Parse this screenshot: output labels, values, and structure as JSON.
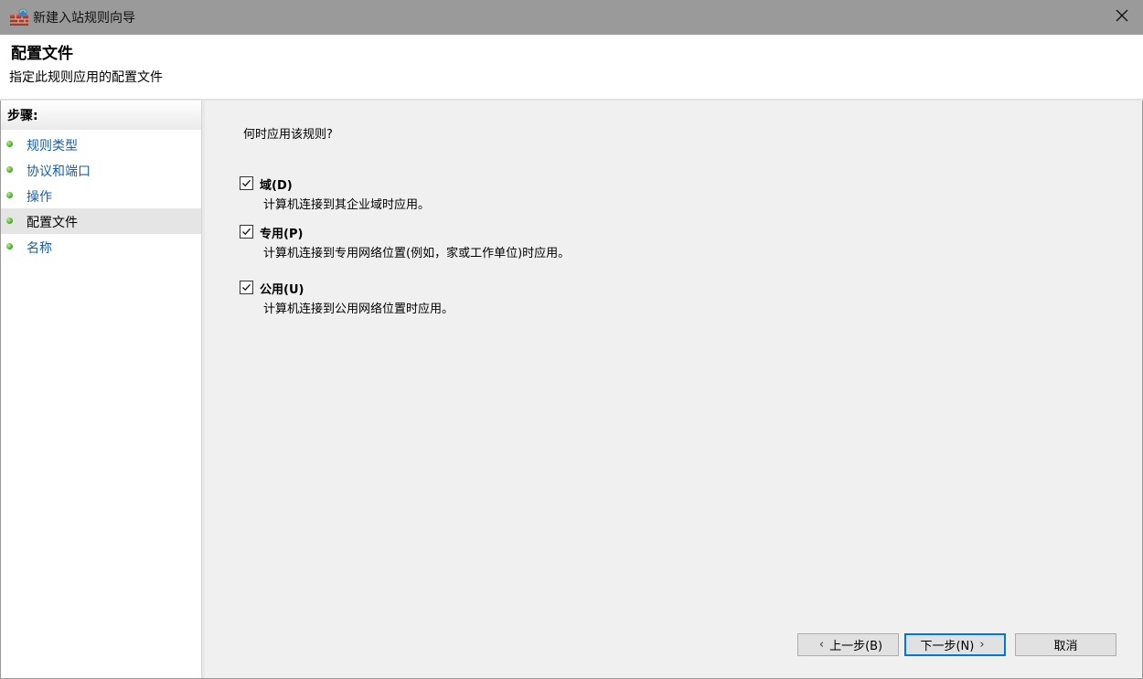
{
  "window": {
    "title": "新建入站规则向导",
    "icon": "firewall-wizard-icon",
    "close_icon": "close-icon"
  },
  "header": {
    "title": "配置文件",
    "subtitle": "指定此规则应用的配置文件"
  },
  "sidebar": {
    "title": "步骤:",
    "items": [
      {
        "label": "规则类型",
        "active": false
      },
      {
        "label": "协议和端口",
        "active": false
      },
      {
        "label": "操作",
        "active": false
      },
      {
        "label": "配置文件",
        "active": true
      },
      {
        "label": "名称",
        "active": false
      }
    ]
  },
  "main": {
    "question": "何时应用该规则?",
    "options": [
      {
        "label": "域(D)",
        "description": "计算机连接到其企业域时应用。",
        "checked": true
      },
      {
        "label": "专用(P)",
        "description": "计算机连接到专用网络位置(例如，家或工作单位)时应用。",
        "checked": true
      },
      {
        "label": "公用(U)",
        "description": "计算机连接到公用网络位置时应用。",
        "checked": true
      }
    ]
  },
  "buttons": {
    "back": "上一步(B)",
    "next": "下一步(N)",
    "cancel": "取消"
  },
  "colors": {
    "titlebar": "#9a9a9a",
    "link": "#1a5fa4",
    "content_bg": "#f0f0f0",
    "focus": "#0078d7"
  }
}
